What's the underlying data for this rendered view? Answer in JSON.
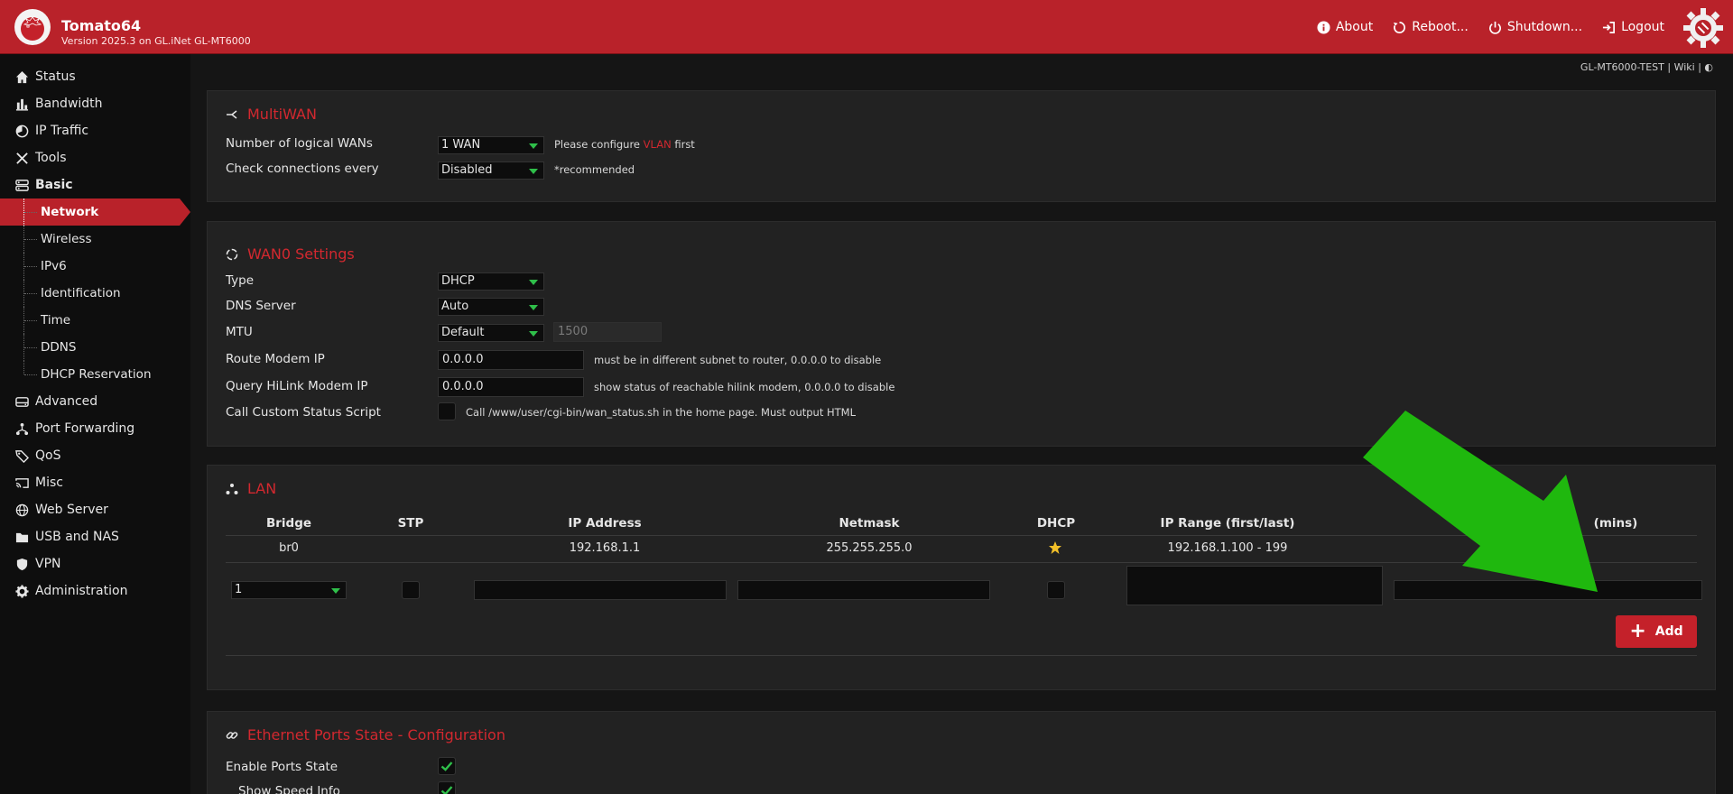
{
  "app": {
    "title": "Tomato64",
    "subtitle": "Version 2025.3 on GL.iNet GL-MT6000"
  },
  "top_nav": [
    {
      "label": "About",
      "icon": "info-icon"
    },
    {
      "label": "Reboot...",
      "icon": "reboot-icon"
    },
    {
      "label": "Shutdown...",
      "icon": "power-icon"
    },
    {
      "label": "Logout",
      "icon": "logout-icon"
    }
  ],
  "sidebar": {
    "items": [
      {
        "label": "Status",
        "icon": "home-icon"
      },
      {
        "label": "Bandwidth",
        "icon": "bar-chart-icon"
      },
      {
        "label": "IP Traffic",
        "icon": "pie-icon"
      },
      {
        "label": "Tools",
        "icon": "tools-icon"
      },
      {
        "label": "Basic",
        "icon": "server-icon"
      },
      {
        "label": "Advanced",
        "icon": "hdd-icon"
      },
      {
        "label": "Port Forwarding",
        "icon": "network-icon"
      },
      {
        "label": "QoS",
        "icon": "tag-icon"
      },
      {
        "label": "Misc",
        "icon": "cast-icon"
      },
      {
        "label": "Web Server",
        "icon": "globe-icon"
      },
      {
        "label": "USB and NAS",
        "icon": "folder-icon"
      },
      {
        "label": "VPN",
        "icon": "shield-icon"
      },
      {
        "label": "Administration",
        "icon": "gear-icon"
      }
    ],
    "basic_sub": [
      "Network",
      "Wireless",
      "IPv6",
      "Identification",
      "Time",
      "DDNS",
      "DHCP Reservation"
    ]
  },
  "breadcrumb": "GL-MT6000-TEST | Wiki | ◐",
  "multiwan": {
    "title": "MultiWAN",
    "num_wans_label": "Number of logical WANs",
    "num_wans_value": "1 WAN",
    "num_wans_note_pre": "Please configure",
    "num_wans_note_link": "VLAN",
    "num_wans_note_post": "first",
    "check_label": "Check connections every",
    "check_value": "Disabled",
    "check_note": "*recommended"
  },
  "wan0": {
    "title": "WAN0 Settings",
    "type_label": "Type",
    "type_value": "DHCP",
    "dns_label": "DNS Server",
    "dns_value": "Auto",
    "mtu_label": "MTU",
    "mtu_value": "Default",
    "mtu_number": "1500",
    "route_label": "Route Modem IP",
    "route_value": "0.0.0.0",
    "route_note": "must be in different subnet to router, 0.0.0.0 to disable",
    "hilink_label": "Query HiLink Modem IP",
    "hilink_value": "0.0.0.0",
    "hilink_note": "show status of reachable hilink modem, 0.0.0.0 to disable",
    "script_label": "Call Custom Status Script",
    "script_note": "Call /www/user/cgi-bin/wan_status.sh in the home page. Must output HTML"
  },
  "lan": {
    "title": "LAN",
    "columns": [
      "Bridge",
      "STP",
      "IP Address",
      "Netmask",
      "DHCP",
      "IP Range (first/last)",
      "(mins)"
    ],
    "row": {
      "bridge": "br0",
      "ip": "192.168.1.1",
      "netmask": "255.255.255.0",
      "range": "192.168.1.100 - 199"
    },
    "new_bridge_value": "1",
    "add_label": "Add"
  },
  "eth": {
    "title": "Ethernet Ports State - Configuration",
    "enable_label": "Enable Ports State",
    "speed_label": "Show Speed Info"
  },
  "colors": {
    "accent": "#b9222a",
    "check": "#2fbf4a",
    "arrow": "#1fb80e"
  }
}
